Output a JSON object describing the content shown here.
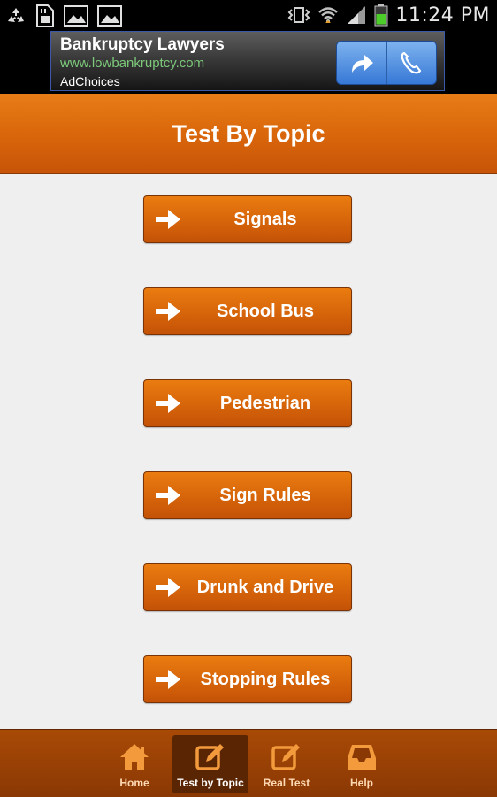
{
  "status_bar": {
    "time": "11:24 PM",
    "left_icons": [
      "recycle-icon",
      "sd-card-icon",
      "image-icon",
      "image-icon"
    ],
    "right_icons": [
      "vibrate-icon",
      "wifi-icon",
      "signal-icon",
      "battery-icon"
    ]
  },
  "ad": {
    "title": "Bankruptcy Lawyers",
    "url": "www.lowbankruptcy.com",
    "choices": "AdChoices",
    "url_color": "#7cc97a"
  },
  "header": {
    "title": "Test By Topic"
  },
  "topics": [
    {
      "label": "Signals"
    },
    {
      "label": "School Bus"
    },
    {
      "label": "Pedestrian"
    },
    {
      "label": "Sign Rules"
    },
    {
      "label": "Drunk and Drive"
    },
    {
      "label": "Stopping Rules"
    }
  ],
  "nav": [
    {
      "label": "Home",
      "icon": "home-icon",
      "active": false
    },
    {
      "label": "Test by Topic",
      "icon": "edit-icon",
      "active": true
    },
    {
      "label": "Real Test",
      "icon": "edit-icon",
      "active": false
    },
    {
      "label": "Help",
      "icon": "inbox-icon",
      "active": false
    }
  ],
  "colors": {
    "accent": "#d8650a",
    "nav_bg": "#8a3804",
    "background": "#efefef"
  }
}
